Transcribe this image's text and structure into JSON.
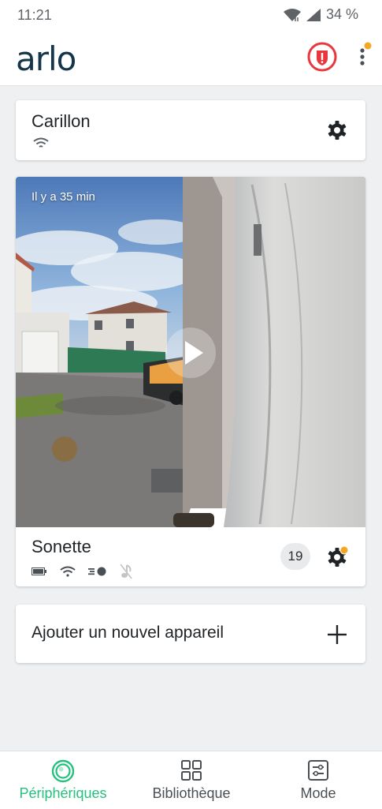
{
  "status_bar": {
    "time": "11:21",
    "battery": "34 %"
  },
  "header": {
    "logo": "arlo"
  },
  "devices": [
    {
      "name": "Carillon"
    },
    {
      "name": "Sonette",
      "last_event": "Il y a 35 min",
      "event_count": "19"
    }
  ],
  "add_device": {
    "label": "Ajouter un nouvel appareil"
  },
  "nav": {
    "devices": "Périphériques",
    "library": "Bibliothèque",
    "mode": "Mode"
  },
  "colors": {
    "brand": "#14354a",
    "accent_green": "#26c07e",
    "alert_red": "#e8383d",
    "notification_orange": "#f5a623"
  }
}
